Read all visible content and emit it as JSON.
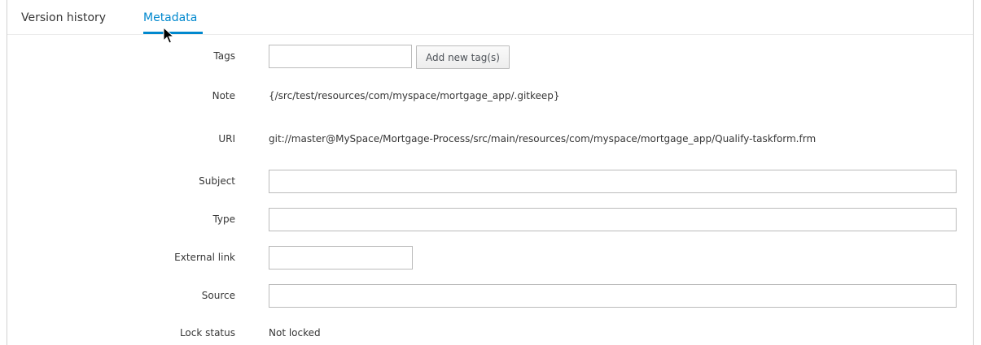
{
  "tabs": [
    {
      "label": "Version history",
      "active": false
    },
    {
      "label": "Metadata",
      "active": true
    }
  ],
  "accent_color": "#0088ce",
  "form": {
    "tags": {
      "label": "Tags",
      "value": "",
      "button_label": "Add new tag(s)"
    },
    "note": {
      "label": "Note",
      "value": "{/src/test/resources/com/myspace/mortgage_app/.gitkeep}"
    },
    "uri": {
      "label": "URI",
      "value": "git://master@MySpace/Mortgage-Process/src/main/resources/com/myspace/mortgage_app/Qualify-taskform.frm"
    },
    "subject": {
      "label": "Subject",
      "value": ""
    },
    "type": {
      "label": "Type",
      "value": ""
    },
    "external_link": {
      "label": "External link",
      "value": ""
    },
    "source": {
      "label": "Source",
      "value": ""
    },
    "lock_status": {
      "label": "Lock status",
      "value": "Not locked"
    }
  }
}
